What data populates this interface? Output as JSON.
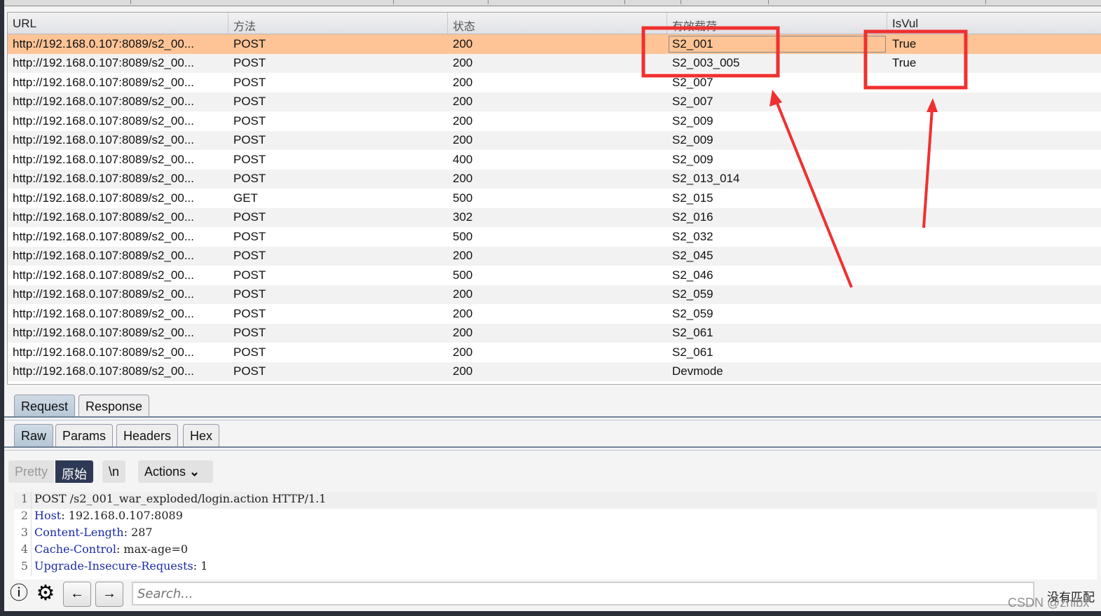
{
  "table": {
    "columns": [
      "URL",
      "方法",
      "状态",
      "有效载荷",
      "IsVul"
    ],
    "rows": [
      {
        "url": "http://192.168.0.107:8089/s2_00...",
        "method": "POST",
        "status": "200",
        "payload": "S2_001",
        "isvul": "True",
        "selected": true
      },
      {
        "url": "http://192.168.0.107:8089/s2_00...",
        "method": "POST",
        "status": "200",
        "payload": "S2_003_005",
        "isvul": "True"
      },
      {
        "url": "http://192.168.0.107:8089/s2_00...",
        "method": "POST",
        "status": "200",
        "payload": "S2_007",
        "isvul": ""
      },
      {
        "url": "http://192.168.0.107:8089/s2_00...",
        "method": "POST",
        "status": "200",
        "payload": "S2_007",
        "isvul": ""
      },
      {
        "url": "http://192.168.0.107:8089/s2_00...",
        "method": "POST",
        "status": "200",
        "payload": "S2_009",
        "isvul": ""
      },
      {
        "url": "http://192.168.0.107:8089/s2_00...",
        "method": "POST",
        "status": "200",
        "payload": "S2_009",
        "isvul": ""
      },
      {
        "url": "http://192.168.0.107:8089/s2_00...",
        "method": "POST",
        "status": "400",
        "payload": "S2_009",
        "isvul": ""
      },
      {
        "url": "http://192.168.0.107:8089/s2_00...",
        "method": "POST",
        "status": "200",
        "payload": "S2_013_014",
        "isvul": ""
      },
      {
        "url": "http://192.168.0.107:8089/s2_00...",
        "method": "GET",
        "status": "500",
        "payload": "S2_015",
        "isvul": ""
      },
      {
        "url": "http://192.168.0.107:8089/s2_00...",
        "method": "POST",
        "status": "302",
        "payload": "S2_016",
        "isvul": ""
      },
      {
        "url": "http://192.168.0.107:8089/s2_00...",
        "method": "POST",
        "status": "500",
        "payload": "S2_032",
        "isvul": ""
      },
      {
        "url": "http://192.168.0.107:8089/s2_00...",
        "method": "POST",
        "status": "200",
        "payload": "S2_045",
        "isvul": ""
      },
      {
        "url": "http://192.168.0.107:8089/s2_00...",
        "method": "POST",
        "status": "500",
        "payload": "S2_046",
        "isvul": ""
      },
      {
        "url": "http://192.168.0.107:8089/s2_00...",
        "method": "POST",
        "status": "200",
        "payload": "S2_059",
        "isvul": ""
      },
      {
        "url": "http://192.168.0.107:8089/s2_00...",
        "method": "POST",
        "status": "200",
        "payload": "S2_059",
        "isvul": ""
      },
      {
        "url": "http://192.168.0.107:8089/s2_00...",
        "method": "POST",
        "status": "200",
        "payload": "S2_061",
        "isvul": ""
      },
      {
        "url": "http://192.168.0.107:8089/s2_00...",
        "method": "POST",
        "status": "200",
        "payload": "S2_061",
        "isvul": ""
      },
      {
        "url": "http://192.168.0.107:8089/s2_00...",
        "method": "POST",
        "status": "200",
        "payload": "Devmode",
        "isvul": ""
      }
    ]
  },
  "tabs": {
    "main": [
      "Request",
      "Response"
    ],
    "sub": [
      "Raw",
      "Params",
      "Headers",
      "Hex"
    ]
  },
  "view": {
    "pretty": "Pretty",
    "raw": "原始",
    "newline": "\\n",
    "actions": "Actions"
  },
  "request_lines": [
    {
      "key": "",
      "text": "POST /s2_001_war_exploded/login.action HTTP/1.1"
    },
    {
      "key": "Host",
      "text": " 192.168.0.107:8089"
    },
    {
      "key": "Content-Length",
      "text": " 287"
    },
    {
      "key": "Cache-Control",
      "text": " max-age=0"
    },
    {
      "key": "Upgrade-Insecure-Requests",
      "text": " 1"
    }
  ],
  "search": {
    "placeholder": "Search...",
    "status": "没有匹配"
  },
  "watermark": "CSDN @zhibx",
  "colors": {
    "selected_row": "#ffc496",
    "annotation": "#f03030",
    "header_key": "#1a2aa8"
  }
}
